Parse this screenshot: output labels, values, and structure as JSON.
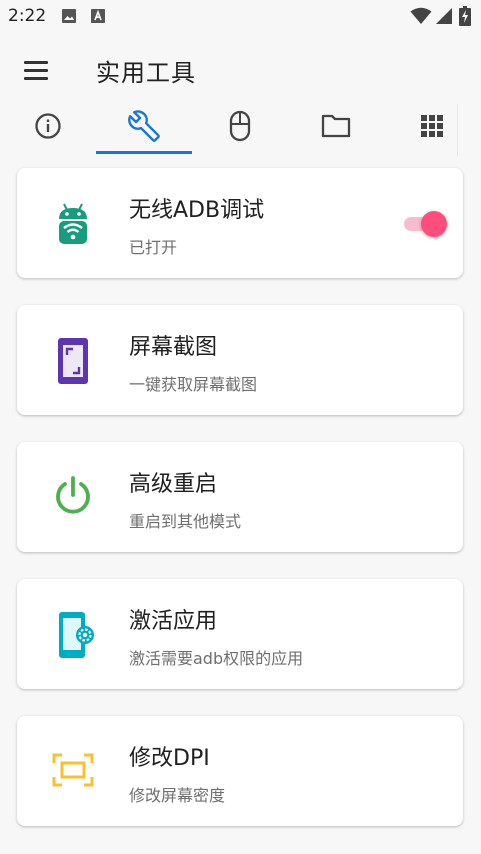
{
  "status_bar": {
    "time": "2:22",
    "left_icons": [
      "image-icon",
      "font-a-icon"
    ],
    "right_icons": [
      "wifi-icon",
      "signal-icon",
      "battery-charging-icon"
    ]
  },
  "app_bar": {
    "title": "实用工具",
    "menu_icon": "menu-icon"
  },
  "tabs": [
    {
      "icon": "info-icon",
      "selected": false
    },
    {
      "icon": "wrench-icon",
      "selected": true
    },
    {
      "icon": "mouse-icon",
      "selected": false
    },
    {
      "icon": "folder-icon",
      "selected": false
    },
    {
      "icon": "grid-icon",
      "selected": false
    }
  ],
  "colors": {
    "accent": "#1976d2",
    "switch_on": "#ff4d7d",
    "android_green": "#179c7d",
    "screenshot_purple": "#5e35b1",
    "reboot_green": "#4caf50",
    "activate_cyan": "#00acc1",
    "dpi_yellow": "#fbc02d"
  },
  "tools": [
    {
      "title": "无线ADB调试",
      "subtitle": "已打开",
      "icon": "android-wifi-icon",
      "toggle": true,
      "toggle_on": true
    },
    {
      "title": "屏幕截图",
      "subtitle": "一键获取屏幕截图",
      "icon": "screenshot-icon"
    },
    {
      "title": "高级重启",
      "subtitle": "重启到其他模式",
      "icon": "power-icon"
    },
    {
      "title": "激活应用",
      "subtitle": "激活需要adb权限的应用",
      "icon": "phone-settings-icon"
    },
    {
      "title": "修改DPI",
      "subtitle": "修改屏幕密度",
      "icon": "dpi-frame-icon"
    }
  ]
}
